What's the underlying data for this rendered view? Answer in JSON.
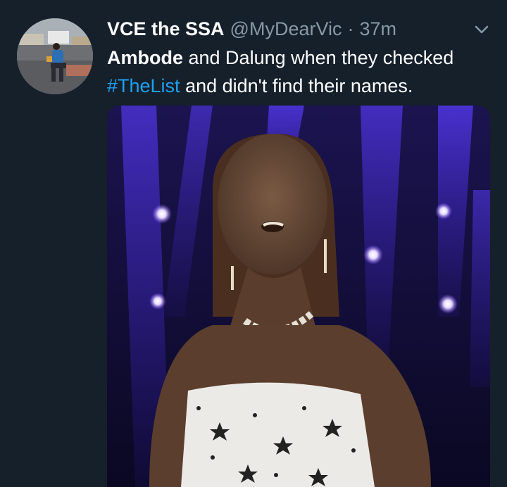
{
  "tweet": {
    "display_name": "VCE the SSA",
    "handle": "@MyDearVic",
    "separator": "·",
    "time": "37m",
    "text_bold": "Ambode",
    "text_part1": " and Dalung when they checked",
    "hashtag": "#TheList",
    "text_part2": " and didn't find their names."
  },
  "icons": {
    "caret": "chevron-down-icon"
  },
  "colors": {
    "background": "#15202b",
    "secondary_text": "#8899a6",
    "link": "#1da1f2"
  }
}
